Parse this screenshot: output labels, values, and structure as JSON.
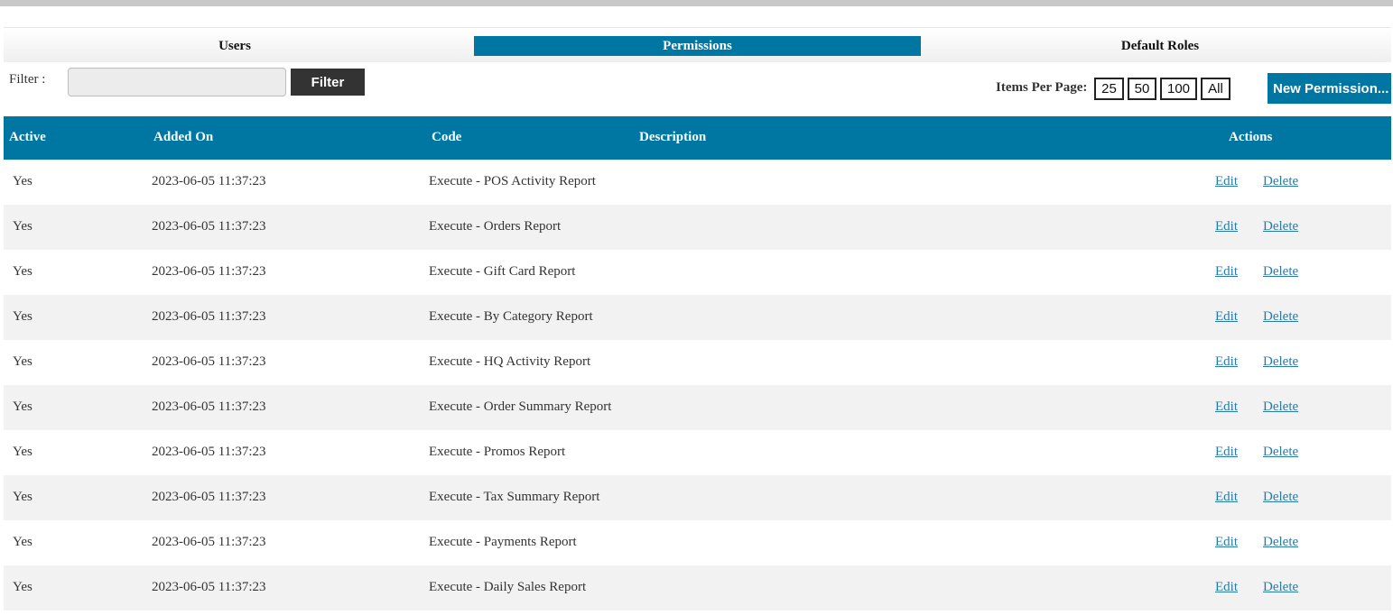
{
  "tabs": {
    "users": "Users",
    "permissions": "Permissions",
    "default_roles": "Default Roles"
  },
  "filter": {
    "label": "Filter :",
    "value": "",
    "placeholder": "",
    "button_label": "Filter"
  },
  "pagination": {
    "label": "Items Per Page:",
    "options": [
      "25",
      "50",
      "100",
      "All"
    ]
  },
  "new_permission_label": "New Permission...",
  "table": {
    "headers": {
      "active": "Active",
      "added_on": "Added On",
      "code": "Code",
      "description": "Description",
      "actions": "Actions"
    },
    "edit_label": "Edit",
    "delete_label": "Delete",
    "rows": [
      {
        "active": "Yes",
        "added_on": "2023-06-05 11:37:23",
        "code": "Execute - POS Activity Report",
        "description": ""
      },
      {
        "active": "Yes",
        "added_on": "2023-06-05 11:37:23",
        "code": "Execute - Orders Report",
        "description": ""
      },
      {
        "active": "Yes",
        "added_on": "2023-06-05 11:37:23",
        "code": "Execute - Gift Card Report",
        "description": ""
      },
      {
        "active": "Yes",
        "added_on": "2023-06-05 11:37:23",
        "code": "Execute - By Category Report",
        "description": ""
      },
      {
        "active": "Yes",
        "added_on": "2023-06-05 11:37:23",
        "code": "Execute - HQ Activity Report",
        "description": ""
      },
      {
        "active": "Yes",
        "added_on": "2023-06-05 11:37:23",
        "code": "Execute - Order Summary Report",
        "description": ""
      },
      {
        "active": "Yes",
        "added_on": "2023-06-05 11:37:23",
        "code": "Execute - Promos Report",
        "description": ""
      },
      {
        "active": "Yes",
        "added_on": "2023-06-05 11:37:23",
        "code": "Execute - Tax Summary Report",
        "description": ""
      },
      {
        "active": "Yes",
        "added_on": "2023-06-05 11:37:23",
        "code": "Execute - Payments Report",
        "description": ""
      },
      {
        "active": "Yes",
        "added_on": "2023-06-05 11:37:23",
        "code": "Execute - Daily Sales Report",
        "description": ""
      }
    ]
  },
  "colors": {
    "accent": "#0077a2",
    "row_alt": "#f2f2f2",
    "link": "#2a7aa8",
    "dark_button": "#333333"
  }
}
